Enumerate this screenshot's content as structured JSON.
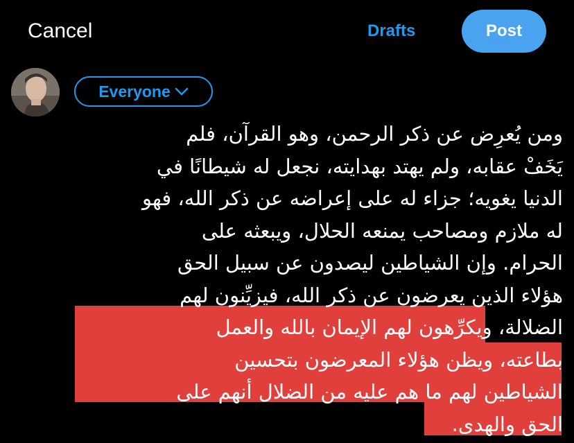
{
  "header": {
    "cancel_label": "Cancel",
    "drafts_label": "Drafts",
    "post_label": "Post"
  },
  "audience": {
    "label": "Everyone"
  },
  "colors": {
    "accent": "#1d9bf0",
    "post_button": "#4aa3ef",
    "highlight": "#e13f3b",
    "background": "#000000"
  },
  "composer": {
    "lines": [
      "ومن يُعرِض عن ذكر الرحمن، وهو القرآن، فلم",
      "يَخَفْ عقابه، ولم يهتد بهدايته، نجعل له شيطانًا في",
      "الدنيا يغويه؛ جزاء له على إعراضه عن ذكر الله، فهو",
      "له ملازم ومصاحب يمنعه الحلال، ويبعثه على",
      "الحرام. وإن الشياطين ليصدون عن سبيل الحق",
      "هؤلاء الذين يعرضون عن ذكر الله، فيزيِّنون لهم"
    ],
    "line7_plain": "الضلالة،",
    "line7_highlight": "ويكرِّهون لهم الإيمان بالله والعمل",
    "highlight_lines": [
      "بطاعته، ويظن هؤلاء المعرضون بتحسين",
      "الشياطين لهم ما هم عليه من الضلال أنهم على",
      "الحق والهدى."
    ]
  }
}
